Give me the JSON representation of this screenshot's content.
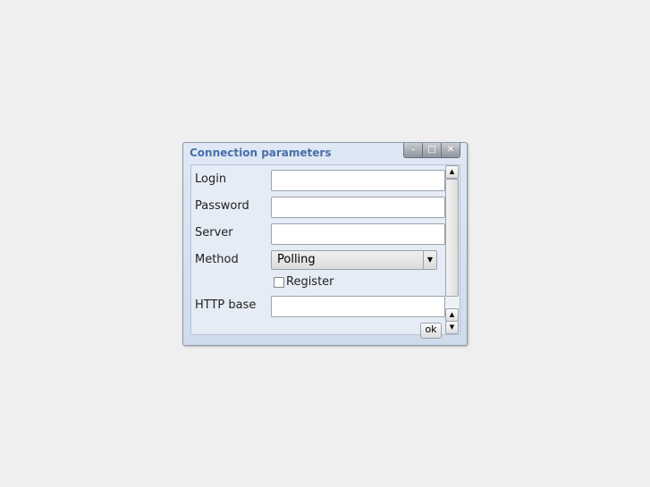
{
  "dialog": {
    "title": "Connection parameters",
    "buttons": {
      "minimize": "–",
      "maximize": "□",
      "close": "✕"
    }
  },
  "form": {
    "login_label": "Login",
    "password_label": "Password",
    "server_label": "Server",
    "method_label": "Method",
    "method_value": "Polling",
    "register_label": "Register",
    "register_checked": false,
    "http_base_label": "HTTP base",
    "ok_label": "ok"
  }
}
